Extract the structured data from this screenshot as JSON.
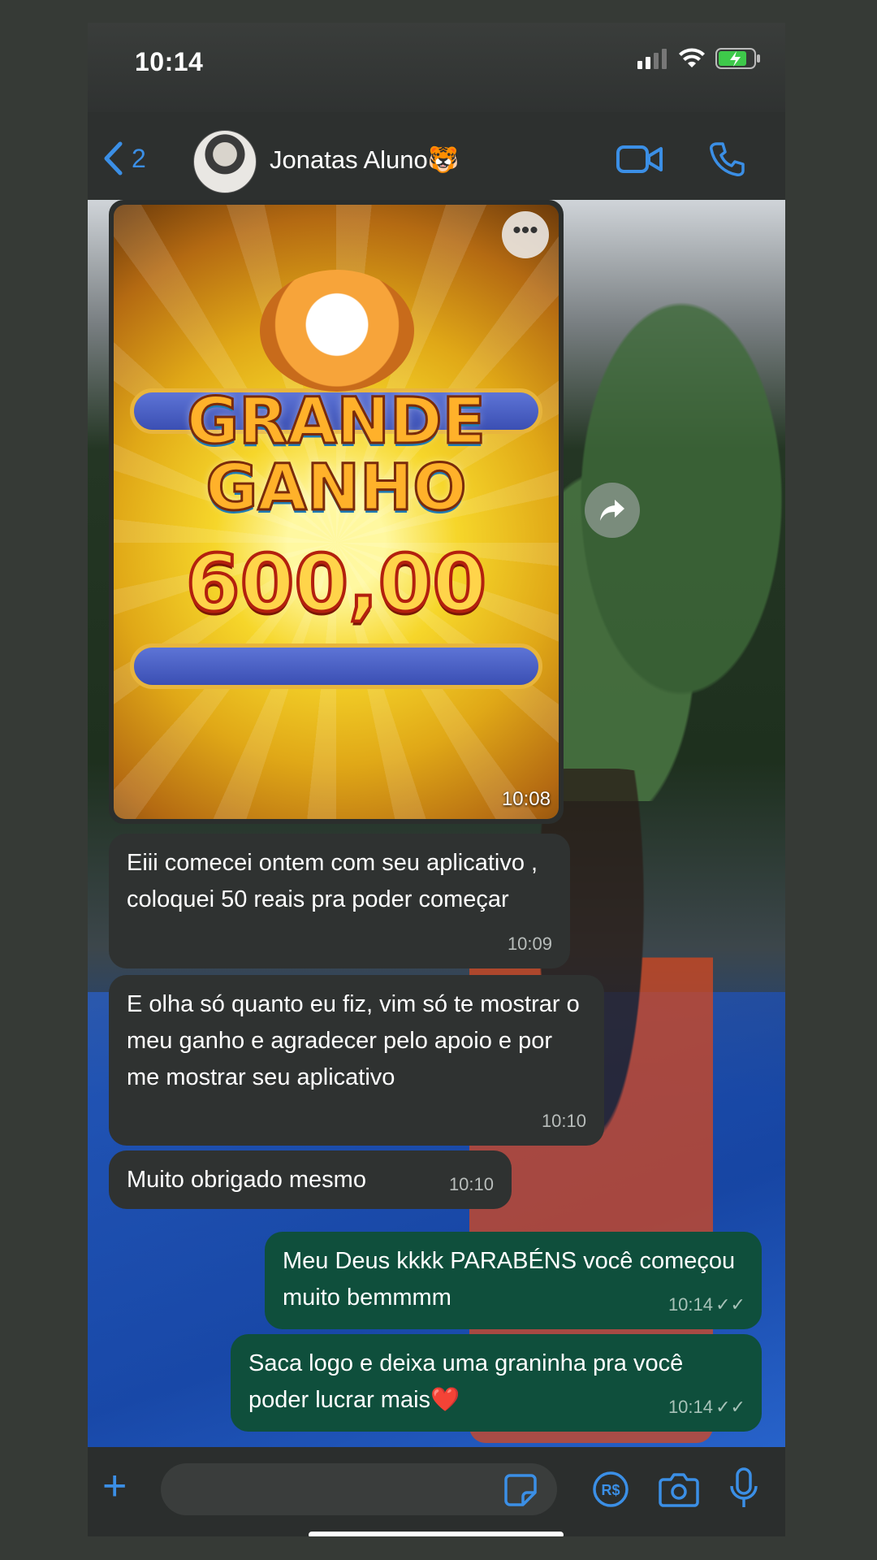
{
  "status_bar": {
    "time": "10:14"
  },
  "header": {
    "back_count": "2",
    "contact_name": "Jonatas Aluno🐯"
  },
  "image_message": {
    "title_line1": "GRANDE",
    "title_line2": "GANHO",
    "amount": "600,00",
    "time": "10:08",
    "more_icon": "ellipsis-icon",
    "forward_icon": "forward-arrow-icon"
  },
  "messages": [
    {
      "direction": "in",
      "text": "Eiii comecei ontem com seu aplicativo , coloquei 50 reais pra poder começar",
      "time": "10:09"
    },
    {
      "direction": "in",
      "text": "E olha só quanto eu fiz, vim só te mostrar o meu ganho e agradecer pelo apoio e por me mostrar seu aplicativo",
      "time": "10:10"
    },
    {
      "direction": "in",
      "text": "Muito obrigado mesmo",
      "time": "10:10"
    },
    {
      "direction": "out",
      "text": "Meu Deus kkkk PARABÉNS você começou muito bemmmm",
      "time": "10:14"
    },
    {
      "direction": "out",
      "text": "Saca logo e deixa uma graninha pra você poder lucrar mais❤️",
      "time": "10:14"
    }
  ],
  "input": {
    "placeholder": ""
  },
  "colors": {
    "accent": "#3b8fe6",
    "incoming": "#2f3231",
    "outgoing": "#0f4f3c"
  }
}
